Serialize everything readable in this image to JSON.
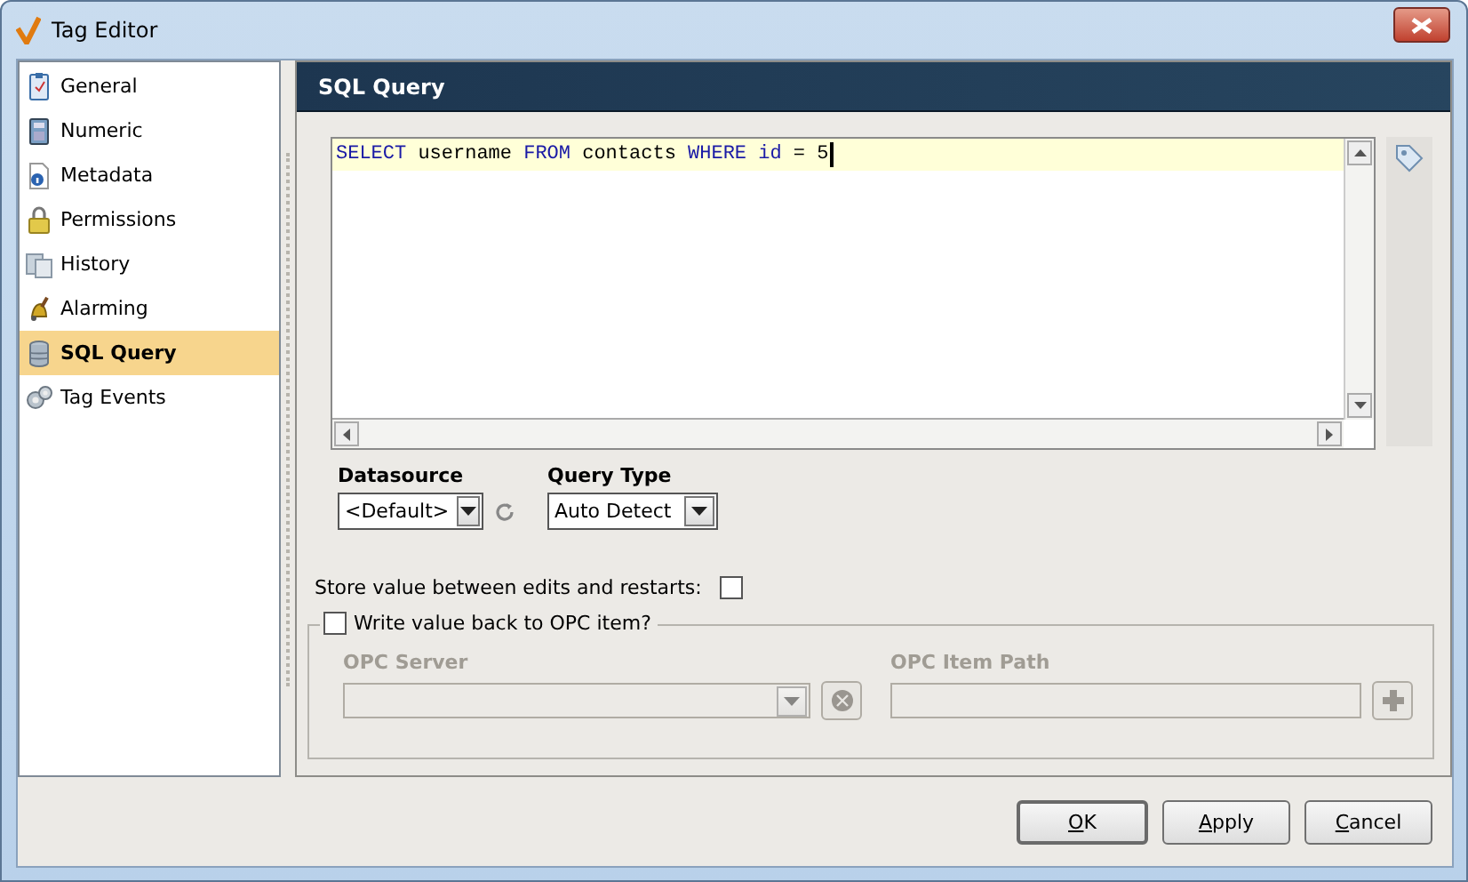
{
  "window": {
    "title": "Tag Editor"
  },
  "sidebar": {
    "items": [
      {
        "label": "General",
        "selected": false
      },
      {
        "label": "Numeric",
        "selected": false
      },
      {
        "label": "Metadata",
        "selected": false
      },
      {
        "label": "Permissions",
        "selected": false
      },
      {
        "label": "History",
        "selected": false
      },
      {
        "label": "Alarming",
        "selected": false
      },
      {
        "label": "SQL Query",
        "selected": true
      },
      {
        "label": "Tag Events",
        "selected": false
      }
    ]
  },
  "panel": {
    "title": "SQL Query"
  },
  "editor": {
    "tokens": [
      {
        "text": "SELECT",
        "kind": "keyword"
      },
      {
        "text": "username",
        "kind": "plain"
      },
      {
        "text": "FROM",
        "kind": "keyword"
      },
      {
        "text": "contacts",
        "kind": "plain"
      },
      {
        "text": "WHERE",
        "kind": "keyword"
      },
      {
        "text": "id",
        "kind": "keyword"
      },
      {
        "text": "=",
        "kind": "plain"
      },
      {
        "text": "5",
        "kind": "plain"
      }
    ]
  },
  "datasource": {
    "label": "Datasource",
    "value": "<Default>"
  },
  "query_type": {
    "label": "Query Type",
    "value": "Auto Detect"
  },
  "store_value": {
    "label": "Store value between edits and restarts:",
    "checked": false
  },
  "write_back": {
    "label": "Write value back to OPC item?",
    "checked": false,
    "opc_server": {
      "label": "OPC Server",
      "disabled": true
    },
    "opc_item_path": {
      "label": "OPC Item Path",
      "disabled": true
    }
  },
  "buttons": [
    {
      "mnemonic": "O",
      "rest": "K",
      "default": true
    },
    {
      "mnemonic": "A",
      "rest": "pply",
      "default": false
    },
    {
      "mnemonic": "C",
      "rest": "ancel",
      "default": false
    }
  ]
}
